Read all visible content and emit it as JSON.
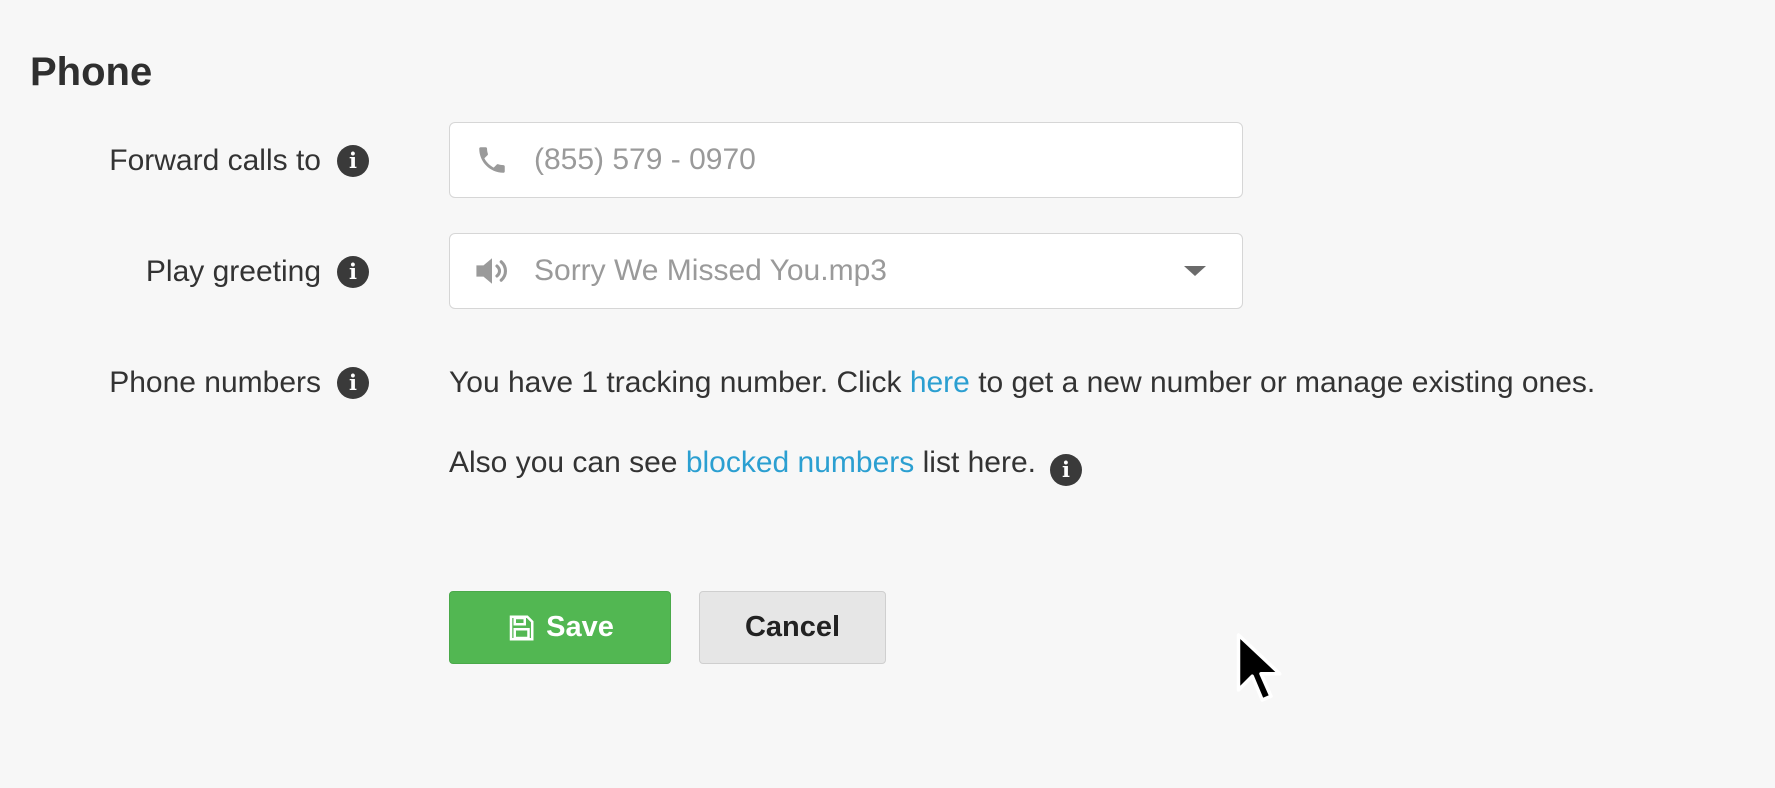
{
  "section": {
    "title": "Phone"
  },
  "forward_calls": {
    "label": "Forward calls to",
    "value": "",
    "placeholder": "(855) 579 - 0970",
    "icon": "phone-icon"
  },
  "play_greeting": {
    "label": "Play greeting",
    "selected": "Sorry We Missed You.mp3",
    "icon": "speaker-icon"
  },
  "phone_numbers": {
    "label": "Phone numbers",
    "line1_prefix": "You have 1 tracking number. Click ",
    "line1_link": "here",
    "line1_suffix": " to get a new number or manage existing ones.",
    "line2_prefix": "Also you can see ",
    "line2_link": "blocked numbers",
    "line2_suffix": " list here."
  },
  "buttons": {
    "save_label": "Save",
    "cancel_label": "Cancel"
  },
  "info_glyph": "i",
  "colors": {
    "link": "#2b9fd1",
    "save": "#52b752",
    "cancel": "#e6e6e6",
    "background": "#f7f7f7"
  }
}
